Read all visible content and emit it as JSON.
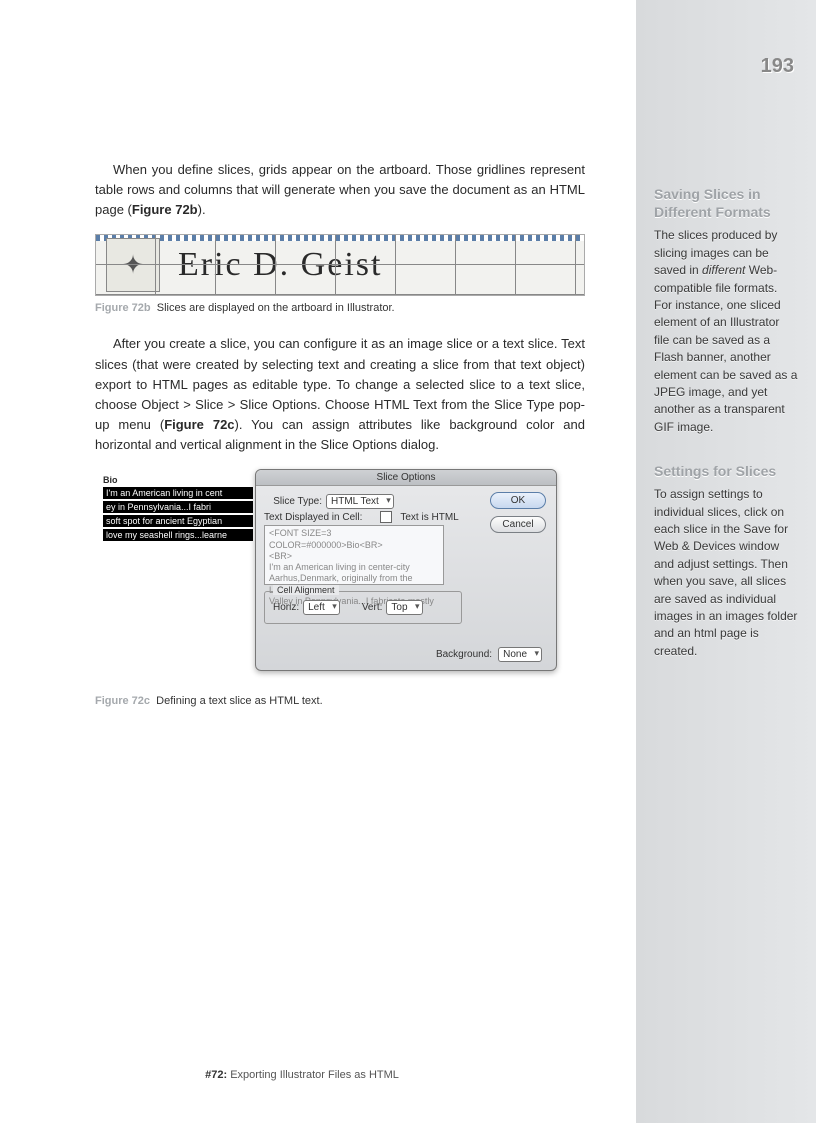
{
  "page_number": "193",
  "main": {
    "p1_a": "When you define slices, grids appear on the artboard. Those gridlines represent table rows and columns that will generate when you save the document as an HTML page (",
    "p1_b": "Figure 72b",
    "p1_c": ").",
    "fig72b_name": "Eric D. Geist",
    "fig72b_label": "Figure 72b",
    "fig72b_caption": "Slices are displayed on the artboard in Illustrator.",
    "p2_a": "After you create a slice, you can configure it as an image slice or a text slice. Text slices (that were created by selecting text and creating a slice from that text object) export to HTML pages as editable type. To change a selected slice to a text slice, choose Object > Slice > Slice Options. Choose HTML Text from the Slice Type pop-up menu (",
    "p2_b": "Figure 72c",
    "p2_c": "). You can assign attributes like background color and horizontal and vertical alignment in the Slice Options dialog.",
    "fig72c": {
      "bio_title": "Bio",
      "bio1": "I'm an American living in cent",
      "bio2": "ey in Pennsylvania...I fabri",
      "bio3": "soft spot for ancient Egyptian",
      "bio4": "love my seashell rings...learne",
      "dlg_title": "Slice Options",
      "slice_type_label": "Slice Type:",
      "slice_type_value": "HTML Text",
      "text_disp_label": "Text Displayed in Cell:",
      "text_is_html": "Text is HTML",
      "ta_line1": "<FONT SIZE=3 COLOR=#000000>Bio<BR>",
      "ta_line2": "<BR>",
      "ta_line3": "I'm an American living in center-city",
      "ta_line4": "Aarhus,Denmark, originally from the Lehigh",
      "ta_line5": "Valley in Pennsylvania...I fabricate mostly",
      "align_legend": "Cell Alignment",
      "horiz_label": "Horiz:",
      "horiz_value": "Left",
      "vert_label": "Vert:",
      "vert_value": "Top",
      "bg_label": "Background:",
      "bg_value": "None",
      "ok": "OK",
      "cancel": "Cancel"
    },
    "fig72c_label": "Figure 72c",
    "fig72c_caption": "Defining a text slice as HTML text."
  },
  "sidebar": {
    "head1a": "Saving Slices in",
    "head1b": "Different Formats",
    "body1_a": "The slices produced by slicing images can be saved in ",
    "body1_em": "different",
    "body1_b": " Web-compatible file formats. For instance, one sliced element of an Illustrator file can be saved as a Flash banner, another element can be saved as a JPEG image, and yet another as a transparent GIF image.",
    "head2": "Settings for Slices",
    "body2": "To assign settings to individual slices, click on each slice in the Save for Web & Devices window and adjust settings. Then when you save, all slices are saved as individual images in an images folder and an html page is created."
  },
  "footer": {
    "tag": "#72:",
    "title": "Exporting Illustrator Files as HTML"
  }
}
